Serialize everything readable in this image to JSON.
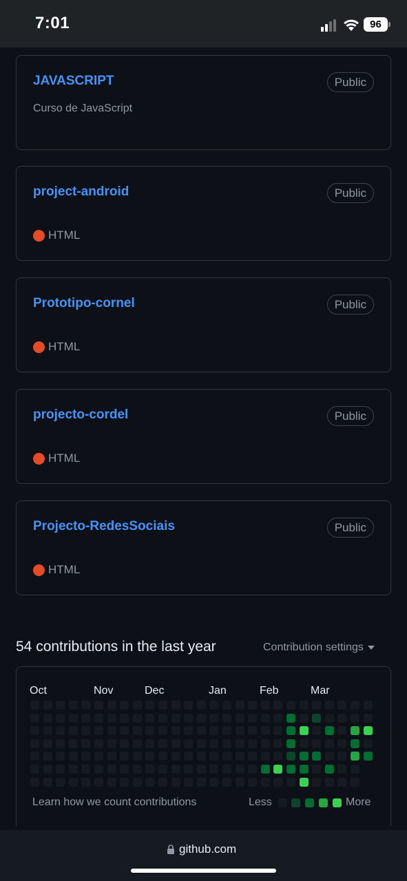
{
  "status_bar": {
    "time": "7:01",
    "battery": "96"
  },
  "repos": [
    {
      "name": "JAVASCRIPT",
      "badge": "Public",
      "description": "Curso de JavaScript",
      "language": ""
    },
    {
      "name": "project-android",
      "badge": "Public",
      "description": "",
      "language": "HTML"
    },
    {
      "name": "Prototipo-cornel",
      "badge": "Public",
      "description": "",
      "language": "HTML"
    },
    {
      "name": "projecto-cordel",
      "badge": "Public",
      "description": "",
      "language": "HTML"
    },
    {
      "name": "Projecto-RedesSociais",
      "badge": "Public",
      "description": "",
      "language": "HTML"
    }
  ],
  "contributions": {
    "title": "54 contributions in the last year",
    "settings_label": "Contribution settings",
    "months": [
      "Oct",
      "Nov",
      "Dec",
      "Jan",
      "Feb",
      "Mar"
    ],
    "learn_link": "Learn how we count contributions",
    "legend_less": "Less",
    "legend_more": "More",
    "colors": {
      "level0": "#161b22",
      "level1": "#0e4429",
      "level2": "#006d32",
      "level3": "#26a641",
      "level4": "#39d353"
    }
  },
  "browser": {
    "url": "github.com"
  }
}
